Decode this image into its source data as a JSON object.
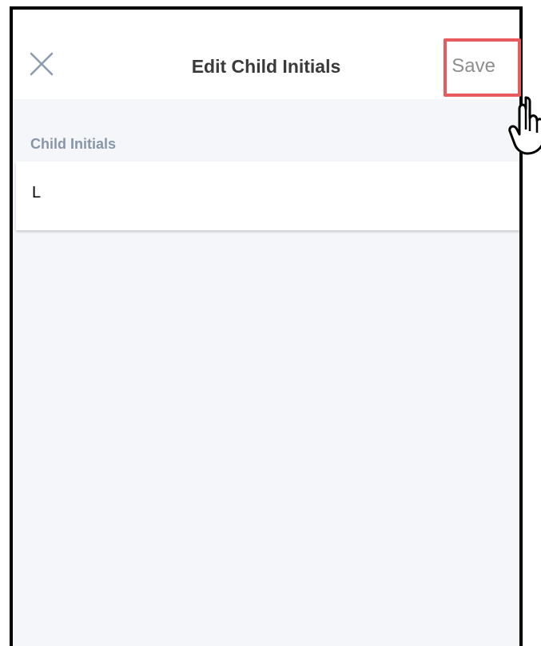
{
  "header": {
    "title": "Edit Child Initials",
    "save_label": "Save",
    "close_icon": "close-icon"
  },
  "form": {
    "section_label": "Child Initials",
    "initials_value": "L"
  },
  "annotation": {
    "highlight_color": "#e85a5e",
    "cursor_icon": "hand-pointer-icon"
  },
  "colors": {
    "background": "#f4f6fa",
    "label": "#8796a8",
    "save_text": "#8e8e8e",
    "title_text": "#3a3a3a"
  }
}
